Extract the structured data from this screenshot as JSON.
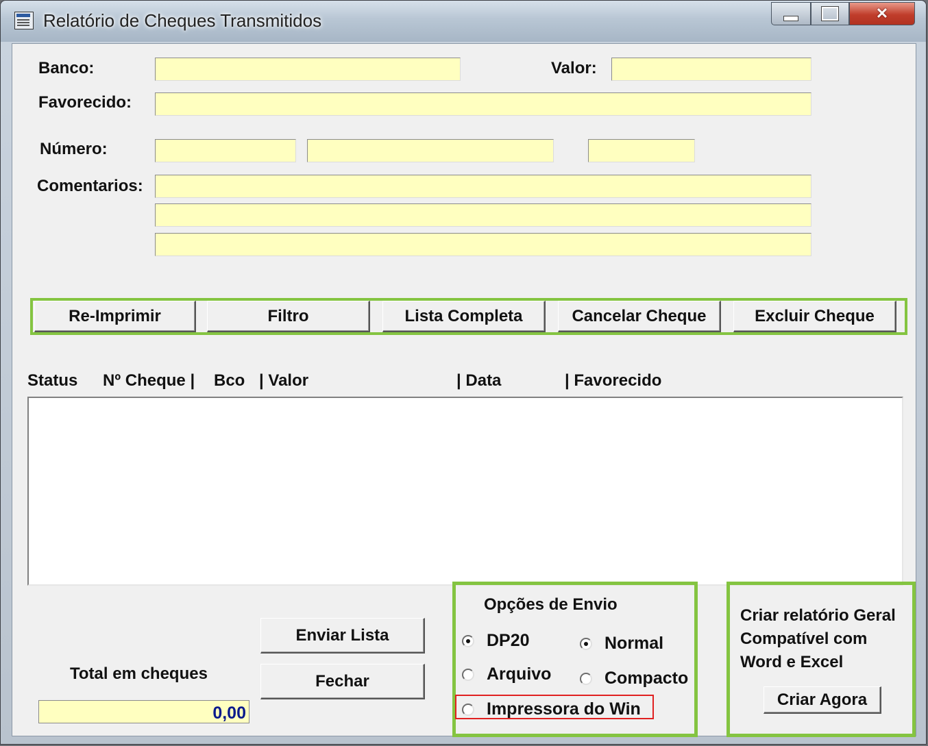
{
  "window": {
    "title": "Relatório de Cheques Transmitidos",
    "controls": {
      "minimize": "",
      "maximize": "",
      "close": "✕"
    }
  },
  "form": {
    "banco_label": "Banco:",
    "valor_label": "Valor:",
    "favorecido_label": "Favorecido:",
    "numero_label": "Número:",
    "comentarios_label": "Comentarios:",
    "banco_value": "",
    "valor_value": "",
    "favorecido_value": "",
    "numero_values": [
      "",
      "",
      ""
    ],
    "comentarios_values": [
      "",
      "",
      ""
    ]
  },
  "actions": {
    "reimprimir": "Re-Imprimir",
    "filtro": "Filtro",
    "lista_completa": "Lista Completa",
    "cancelar_cheque": "Cancelar Cheque",
    "excluir_cheque": "Excluir Cheque"
  },
  "list": {
    "columns": [
      "Status",
      "Nº Cheque |",
      "Bco",
      "|  Valor",
      "| Data",
      "| Favorecido"
    ],
    "rows": []
  },
  "bottom": {
    "enviar_lista": "Enviar Lista",
    "fechar": "Fechar",
    "total_label": "Total em cheques",
    "total_value": "0,00"
  },
  "envio": {
    "title": "Opções de Envio",
    "destino": [
      {
        "label": "DP20",
        "selected": true
      },
      {
        "label": "Arquivo",
        "selected": false
      },
      {
        "label": "Impressora do Win",
        "selected": false
      }
    ],
    "formato": [
      {
        "label": "Normal",
        "selected": true
      },
      {
        "label": "Compacto",
        "selected": false
      }
    ]
  },
  "relatorio": {
    "line1": "Criar relatório Geral",
    "line2": "Compatível com",
    "line3": "Word e Excel",
    "button": "Criar Agora"
  },
  "colors": {
    "field_bg": "#ffffc0",
    "highlight_green": "#84c441",
    "highlight_red": "#e02020",
    "total_text": "#0a1a8c"
  }
}
